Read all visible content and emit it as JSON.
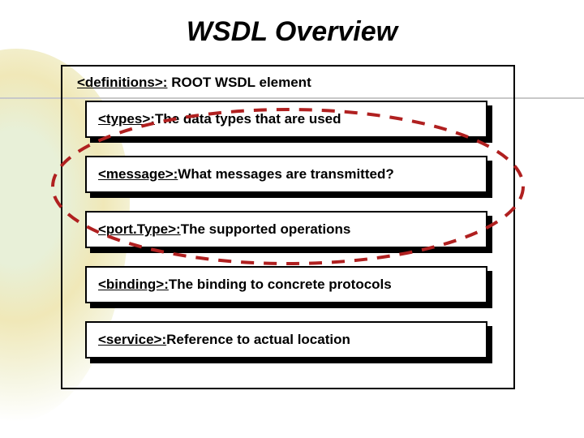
{
  "title": "WSDL Overview",
  "outer": {
    "element": "<definitions>:",
    "desc": " ROOT WSDL element"
  },
  "boxes": [
    {
      "element": "<types>:",
      "desc": " The data types that are used"
    },
    {
      "element": "<message>:",
      "desc": " What messages are transmitted?"
    },
    {
      "element": "<port.Type>:",
      "desc": " The supported operations"
    },
    {
      "element": "<binding>:",
      "desc": " The binding to concrete protocols"
    },
    {
      "element": "<service>:",
      "desc": " Reference to actual location"
    }
  ],
  "colors": {
    "dash": "#b02020"
  }
}
